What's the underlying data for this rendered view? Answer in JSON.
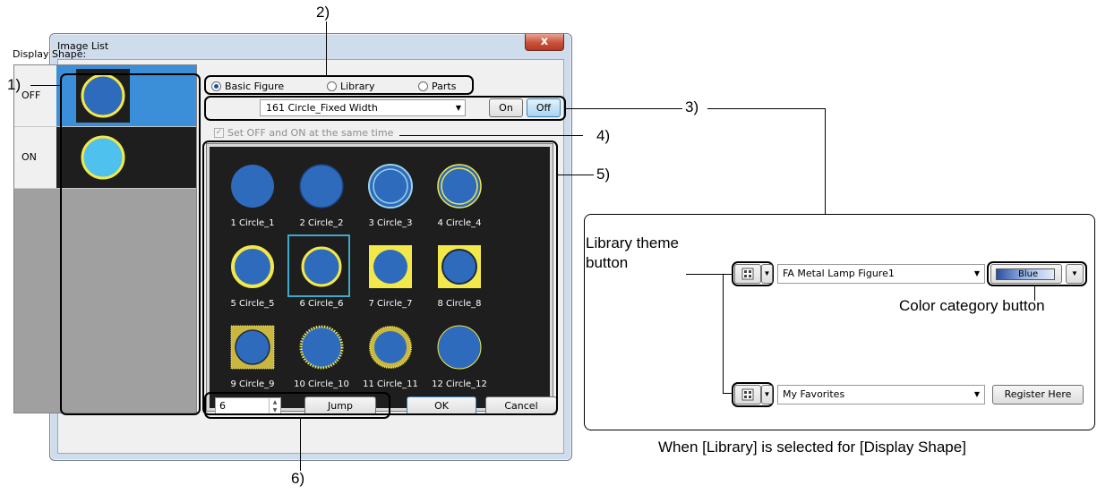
{
  "dialog": {
    "title": "Image List",
    "close_label": "x",
    "display_shape_label": "Display Shape:",
    "states": [
      {
        "label": "OFF"
      },
      {
        "label": "ON"
      }
    ],
    "radios": [
      {
        "label": "Basic Figure",
        "selected": true
      },
      {
        "label": "Library",
        "selected": false
      },
      {
        "label": "Parts",
        "selected": false
      }
    ],
    "figure_select": "161 Circle_Fixed Width",
    "on_label": "On",
    "off_label": "Off",
    "checkbox_label": "Set OFF and ON at the same time",
    "checkbox_mark": "✓",
    "images": [
      {
        "caption": "1 Circle_1",
        "style": "filled"
      },
      {
        "caption": "2 Circle_2",
        "style": "outline-dark"
      },
      {
        "caption": "3 Circle_3",
        "style": "double-light"
      },
      {
        "caption": "4 Circle_4",
        "style": "double-yellow"
      },
      {
        "caption": "5 Circle_5",
        "style": "yellow-ring"
      },
      {
        "caption": "6 Circle_6",
        "style": "yellow-ring-thin",
        "selected": true
      },
      {
        "caption": "7 Circle_7",
        "style": "yellow-square"
      },
      {
        "caption": "8 Circle_8",
        "style": "yellow-square-dark"
      },
      {
        "caption": "9 Circle_9",
        "style": "dotted-square"
      },
      {
        "caption": "10 Circle_10",
        "style": "dotted-ring"
      },
      {
        "caption": "11 Circle_11",
        "style": "dotted-thick"
      },
      {
        "caption": "12 Circle_12",
        "style": "thin-yellow"
      }
    ],
    "jump_value": "6",
    "jump_label": "Jump",
    "ok_label": "OK",
    "cancel_label": "Cancel"
  },
  "callouts": {
    "c1": "1)",
    "c2": "2)",
    "c3": "3)",
    "c4": "4)",
    "c5": "5)",
    "c6": "6)"
  },
  "library_panel": {
    "theme_label_line1": "Library theme",
    "theme_label_line2": "button",
    "combo1": "FA Metal Lamp Figure1",
    "color_button": "Blue",
    "color_label": "Color category button",
    "combo2": "My Favorites",
    "register_label": "Register Here",
    "caption": "When [Library] is selected for [Display Shape]"
  },
  "colors": {
    "circle_blue": "#2e6bbd",
    "ring_yellow": "#f3e84a",
    "selection": "#3fa9c9",
    "on_cyan": "#4fc1ee"
  }
}
